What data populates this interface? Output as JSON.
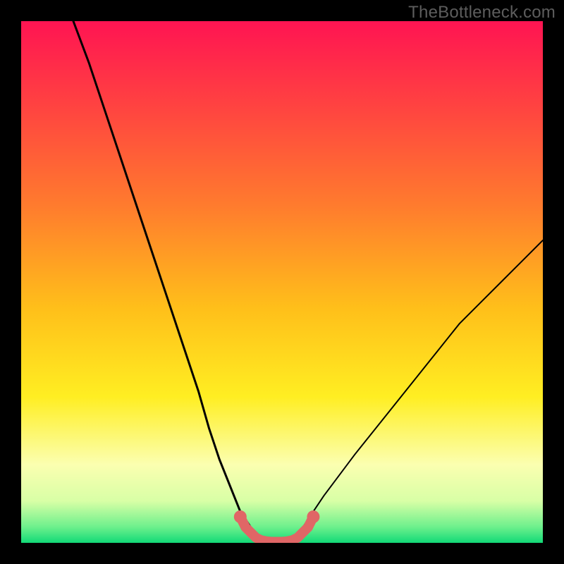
{
  "watermark": "TheBottleneck.com",
  "colors": {
    "frame": "#000000",
    "curve": "#000000",
    "highlight": "#e06666",
    "gradient_stops": [
      {
        "offset": 0.0,
        "color": "#ff1452"
      },
      {
        "offset": 0.15,
        "color": "#ff3f42"
      },
      {
        "offset": 0.35,
        "color": "#ff7a2e"
      },
      {
        "offset": 0.55,
        "color": "#ffbf1a"
      },
      {
        "offset": 0.72,
        "color": "#ffee22"
      },
      {
        "offset": 0.85,
        "color": "#fbffb0"
      },
      {
        "offset": 0.92,
        "color": "#d8ffa6"
      },
      {
        "offset": 0.97,
        "color": "#6cf08c"
      },
      {
        "offset": 1.0,
        "color": "#12d977"
      }
    ]
  },
  "chart_data": {
    "type": "line",
    "title": "",
    "xlabel": "",
    "ylabel": "",
    "xlim": [
      0,
      100
    ],
    "ylim": [
      0,
      100
    ],
    "series": [
      {
        "name": "curve-left",
        "x": [
          10,
          13,
          16,
          19,
          22,
          25,
          28,
          31,
          34,
          36,
          38,
          40,
          42,
          44
        ],
        "y": [
          100,
          92,
          83,
          74,
          65,
          56,
          47,
          38,
          29,
          22,
          16,
          11,
          6,
          3
        ]
      },
      {
        "name": "curve-right",
        "x": [
          54,
          56,
          58,
          61,
          64,
          68,
          72,
          76,
          80,
          84,
          88,
          92,
          96,
          100
        ],
        "y": [
          3,
          6,
          9,
          13,
          17,
          22,
          27,
          32,
          37,
          42,
          46,
          50,
          54,
          58
        ]
      },
      {
        "name": "highlighted-bottom",
        "x": [
          42,
          43,
          44,
          45,
          46,
          47,
          48,
          49,
          50,
          51,
          52,
          53,
          54,
          55,
          56
        ],
        "y": [
          5,
          3,
          2,
          1,
          0.5,
          0.3,
          0.2,
          0.2,
          0.2,
          0.3,
          0.5,
          1,
          2,
          3,
          5
        ]
      }
    ],
    "annotations": []
  }
}
